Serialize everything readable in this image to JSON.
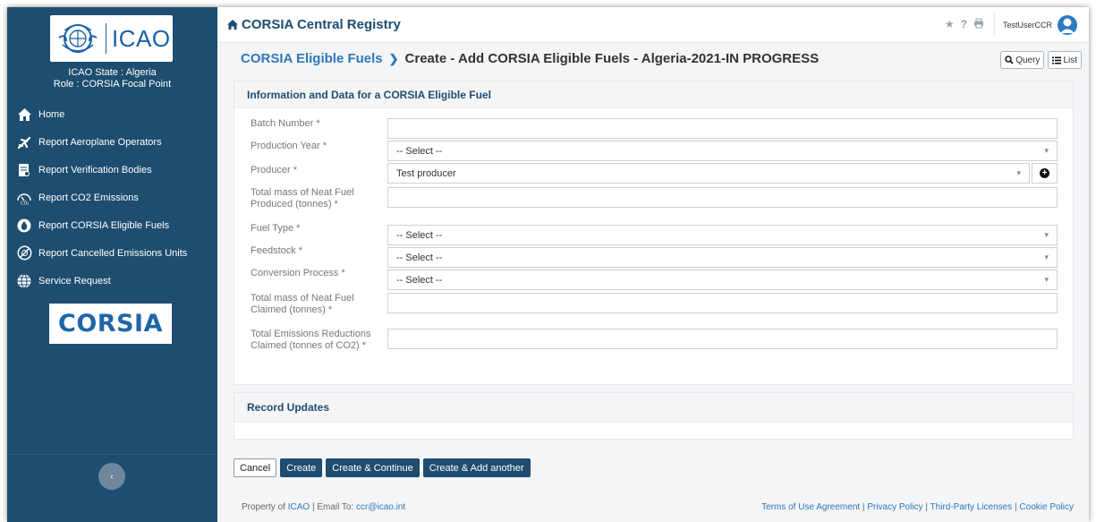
{
  "sidebar": {
    "logo_text": "ICAO",
    "state_line": "ICAO State : Algeria",
    "role_line": "Role : CORSIA Focal Point",
    "items": [
      {
        "label": "Home",
        "icon": "home-icon"
      },
      {
        "label": "Report Aeroplane Operators",
        "icon": "airplane-icon"
      },
      {
        "label": "Report Verification Bodies",
        "icon": "document-icon"
      },
      {
        "label": "Report CO2 Emissions",
        "icon": "co2-gauge-icon"
      },
      {
        "label": "Report CORSIA Eligible Fuels",
        "icon": "fuel-drop-icon"
      },
      {
        "label": "Report Cancelled Emissions Units",
        "icon": "cancelled-units-icon"
      },
      {
        "label": "Service Request",
        "icon": "globe-icon"
      }
    ],
    "corsia_logo_text": "CORSIA",
    "collapse_icon": "chevron-left-icon"
  },
  "topbar": {
    "app_title": "CORSIA Central Registry",
    "icons": [
      "star-icon",
      "help-icon",
      "print-icon"
    ],
    "username": "TestUserCCR"
  },
  "breadcrumb": {
    "parent": "CORSIA Eligible Fuels",
    "current": "Create - Add CORSIA Eligible Fuels - Algeria-2021-IN PROGRESS"
  },
  "view_buttons": {
    "query": "Query",
    "list": "List"
  },
  "form": {
    "title": "Information and Data for a CORSIA Eligible Fuel",
    "fields": {
      "batch_number": {
        "label": "Batch Number *",
        "value": ""
      },
      "production_year": {
        "label": "Production Year *",
        "value": "-- Select --"
      },
      "producer": {
        "label": "Producer *",
        "value": "Test producer"
      },
      "total_mass_produced": {
        "label": "Total mass of Neat Fuel Produced (tonnes) *",
        "value": ""
      },
      "fuel_type": {
        "label": "Fuel Type *",
        "value": "-- Select --"
      },
      "feedstock": {
        "label": "Feedstock *",
        "value": "-- Select --"
      },
      "conversion_process": {
        "label": "Conversion Process *",
        "value": "-- Select --"
      },
      "total_mass_claimed": {
        "label": "Total mass of Neat Fuel Claimed (tonnes) *",
        "value": ""
      },
      "total_emissions_reductions": {
        "label": "Total Emissions Reductions Claimed (tonnes of CO2) *",
        "value": ""
      }
    }
  },
  "record_updates": {
    "title": "Record Updates"
  },
  "actions": {
    "cancel": "Cancel",
    "create": "Create",
    "create_continue": "Create & Continue",
    "create_add_another": "Create & Add another"
  },
  "footer": {
    "property_prefix": "Property of",
    "property_link": "ICAO",
    "email_prefix": "| Email To:",
    "email": "ccr@icao.int",
    "links": [
      "Terms of Use Agreement",
      "Privacy Policy",
      "Third-Party Licenses",
      "Cookie Policy"
    ]
  }
}
